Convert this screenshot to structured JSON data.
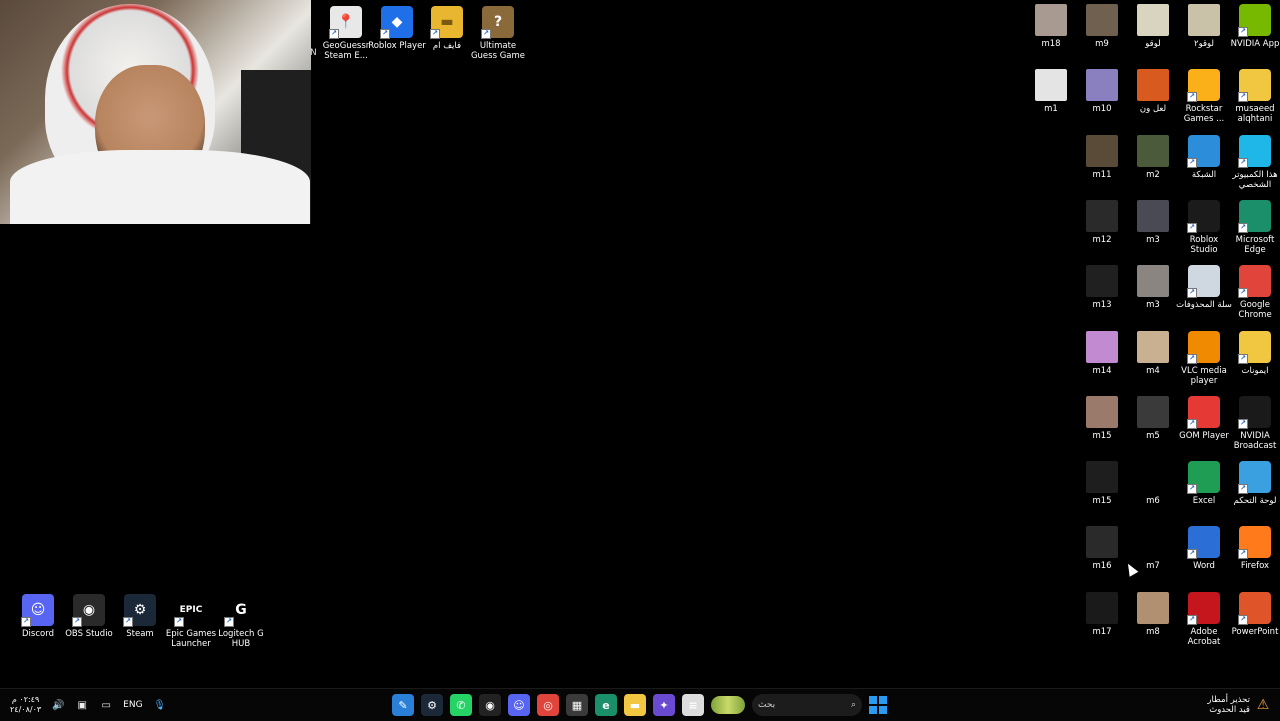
{
  "webcam": {
    "edge_letter": "N"
  },
  "desktop_icons_top": [
    {
      "label": "GeoGuessr Steam E...",
      "icon": "geoguessr-icon",
      "bg": "#e8e8e8",
      "fg": "#c2185b",
      "glyph": "📍"
    },
    {
      "label": "Roblox Player",
      "icon": "roblox-player-icon",
      "bg": "#1e6fe8",
      "fg": "#ffffff",
      "glyph": "◆"
    },
    {
      "label": "فايف ام",
      "icon": "folder-icon",
      "bg": "#e9b62f",
      "fg": "#7a5a10",
      "glyph": "▬"
    },
    {
      "label": "Ultimate Guess Game",
      "icon": "ultimate-guess-game-icon",
      "bg": "#8a6a3a",
      "fg": "#ffffff",
      "glyph": "?"
    }
  ],
  "desktop_icons_left": [
    {
      "label": "Discord",
      "icon": "discord-icon",
      "bg": "#5865f2",
      "fg": "#ffffff",
      "glyph": "☺"
    },
    {
      "label": "OBS Studio",
      "icon": "obs-studio-icon",
      "bg": "#2a2a2a",
      "fg": "#ffffff",
      "glyph": "◉"
    },
    {
      "label": "Steam",
      "icon": "steam-icon",
      "bg": "#1b2838",
      "fg": "#ffffff",
      "glyph": "⚙"
    },
    {
      "label": "Epic Games Launcher",
      "icon": "epic-games-icon",
      "bg": "#000000",
      "fg": "#ffffff",
      "glyph": "EPIC"
    },
    {
      "label": "Logitech G HUB",
      "icon": "logitech-g-hub-icon",
      "bg": "#000000",
      "fg": "#ffffff",
      "glyph": "G"
    }
  ],
  "desktop_icons_right": [
    [
      {
        "label": "m18",
        "icon": "image-thumb-icon",
        "bg": "#a89a90"
      },
      {
        "label": "m9",
        "icon": "image-thumb-icon",
        "bg": "#6f6050"
      },
      {
        "label": "لوقو",
        "icon": "image-thumb-icon",
        "bg": "#d8d4c0"
      },
      {
        "label": "لوقو٢",
        "icon": "image-thumb-icon",
        "bg": "#c9c1a8"
      },
      {
        "label": "NVIDIA App",
        "icon": "nvidia-app-icon",
        "bg": "#76b900"
      }
    ],
    [
      {
        "label": "m1",
        "icon": "image-thumb-icon",
        "bg": "#e4e4e4"
      },
      {
        "label": "m10",
        "icon": "image-thumb-icon",
        "bg": "#8a80c0"
      },
      {
        "label": "لعل ون",
        "icon": "image-thumb-icon",
        "bg": "#d95a1e"
      },
      {
        "label": "Rockstar Games ...",
        "icon": "rockstar-games-icon",
        "bg": "#fbb01a"
      },
      {
        "label": "musaeed alqhtani",
        "icon": "folder-icon",
        "bg": "#f1c640"
      }
    ],
    [
      {
        "label": "m11",
        "icon": "image-thumb-icon",
        "bg": "#5a4a38"
      },
      {
        "label": "m2",
        "icon": "image-thumb-icon",
        "bg": "#4a5a3a"
      },
      {
        "label": "الشبكة",
        "icon": "network-icon",
        "bg": "#2c8ddb"
      },
      {
        "label": "هذا الكمبيوتر الشخصي",
        "icon": "this-pc-icon",
        "bg": "#1fb6e8"
      }
    ],
    [
      {
        "label": "m12",
        "icon": "image-thumb-icon",
        "bg": "#2a2a2a"
      },
      {
        "label": "m3",
        "icon": "image-thumb-icon",
        "bg": "#4a4a55"
      },
      {
        "label": "Roblox Studio",
        "icon": "roblox-studio-icon",
        "bg": "#1b1b1b"
      },
      {
        "label": "Microsoft Edge",
        "icon": "microsoft-edge-icon",
        "bg": "#1a8f6a"
      }
    ],
    [
      {
        "label": "m13",
        "icon": "image-thumb-icon",
        "bg": "#202020"
      },
      {
        "label": "m3",
        "icon": "image-thumb-icon",
        "bg": "#8a8580"
      },
      {
        "label": "سلة المحذوفات",
        "icon": "recycle-bin-icon",
        "bg": "#cfd8e0"
      },
      {
        "label": "Google Chrome",
        "icon": "google-chrome-icon",
        "bg": "#e0443a"
      }
    ],
    [
      {
        "label": "m14",
        "icon": "image-thumb-icon",
        "bg": "#c28ad0"
      },
      {
        "label": "m4",
        "icon": "image-thumb-icon",
        "bg": "#c8b090"
      },
      {
        "label": "VLC media player",
        "icon": "vlc-icon",
        "bg": "#f08a00"
      },
      {
        "label": "ايمونات",
        "icon": "folder-icon",
        "bg": "#f1c640"
      }
    ],
    [
      {
        "label": "m15",
        "icon": "image-thumb-icon",
        "bg": "#9a7a6a"
      },
      {
        "label": "m5",
        "icon": "image-thumb-icon",
        "bg": "#3a3a3a"
      },
      {
        "label": "GOM Player",
        "icon": "gom-player-icon",
        "bg": "#e53935"
      },
      {
        "label": "NVIDIA Broadcast",
        "icon": "nvidia-broadcast-icon",
        "bg": "#1a1a1a"
      }
    ],
    [
      {
        "label": "m15",
        "icon": "image-thumb-icon",
        "bg": "#1e1e1e"
      },
      {
        "label": "m6",
        "icon": "image-thumb-icon",
        "bg": "#000000"
      },
      {
        "label": "Excel",
        "icon": "excel-icon",
        "bg": "#1f9d55"
      },
      {
        "label": "لوحة التحكم",
        "icon": "control-panel-icon",
        "bg": "#3aa0e0"
      }
    ],
    [
      {
        "label": "m16",
        "icon": "image-thumb-icon",
        "bg": "#2a2a2a"
      },
      {
        "label": "m7",
        "icon": "image-thumb-icon",
        "bg": "#000000"
      },
      {
        "label": "Word",
        "icon": "word-icon",
        "bg": "#2b6fd6"
      },
      {
        "label": "Firefox",
        "icon": "firefox-icon",
        "bg": "#ff7a1a"
      }
    ],
    [
      {
        "label": "m17",
        "icon": "image-thumb-icon",
        "bg": "#1a1a1a"
      },
      {
        "label": "m8",
        "icon": "image-thumb-icon",
        "bg": "#b09070"
      },
      {
        "label": "Adobe Acrobat",
        "icon": "adobe-acrobat-icon",
        "bg": "#c4161c"
      },
      {
        "label": "PowerPoint",
        "icon": "powerpoint-icon",
        "bg": "#e0542a"
      }
    ]
  ],
  "taskbar": {
    "time": "٠٢:٤٩ م",
    "date": "٢٤/٠٨/٠٣",
    "lang": "ENG",
    "search_placeholder": "بحث",
    "weather_line1": "تحذير أمطار",
    "weather_line2": "قيد الحدوث",
    "apps": [
      {
        "name": "app-icon",
        "bg": "#2a7fd6",
        "glyph": "✎"
      },
      {
        "name": "steam-icon",
        "bg": "#1b2838",
        "glyph": "⚙"
      },
      {
        "name": "whatsapp-icon",
        "bg": "#25d366",
        "glyph": "✆"
      },
      {
        "name": "obs-studio-icon",
        "bg": "#222222",
        "glyph": "◉"
      },
      {
        "name": "discord-icon",
        "bg": "#5865f2",
        "glyph": "☺"
      },
      {
        "name": "google-chrome-icon",
        "bg": "#e0443a",
        "glyph": "◎"
      },
      {
        "name": "microsoft-store-icon",
        "bg": "#3a3a3a",
        "glyph": "▦"
      },
      {
        "name": "microsoft-edge-icon",
        "bg": "#1a8f6a",
        "glyph": "e"
      },
      {
        "name": "file-explorer-icon",
        "bg": "#f1c640",
        "glyph": "▬"
      },
      {
        "name": "copilot-icon",
        "bg": "#6a4ad0",
        "glyph": "✦"
      },
      {
        "name": "notepad-icon",
        "bg": "#dddddd",
        "glyph": "≡"
      }
    ]
  }
}
